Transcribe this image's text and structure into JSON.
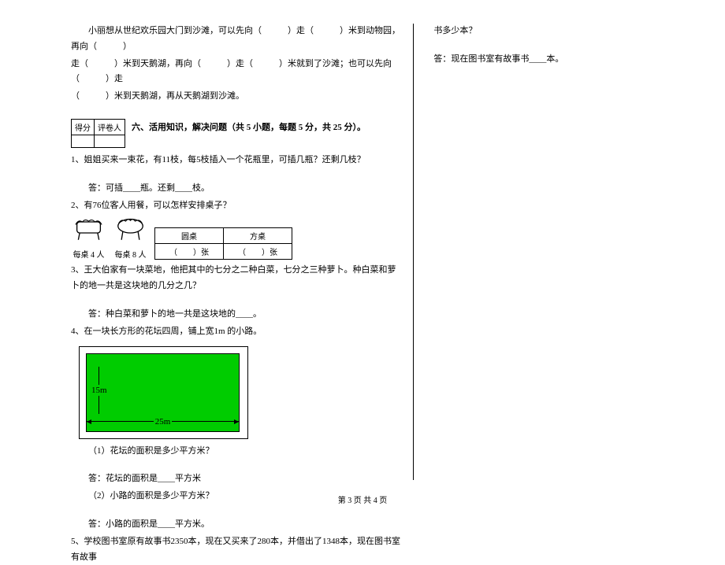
{
  "top": {
    "line1": "小丽想从世纪欢乐园大门到沙滩，可以先向（　　　）走（　　　）米到动物园，再向（　　　）",
    "line2": "走（　　　）米到天鹅湖，再向（　　　）走（　　　）米就到了沙滩；也可以先向（　　　）走",
    "line3": "（　　　）米到天鹅湖，再从天鹅湖到沙滩。"
  },
  "score": {
    "c1": "得分",
    "c2": "评卷人"
  },
  "section6": "六、活用知识，解决问题（共 5 小题，每题 5 分，共 25 分）。",
  "q1": {
    "text": "1、姐姐买来一束花，有11枝，每5枝插入一个花瓶里，可插几瓶？还剩几枝？",
    "ans": "答：可插____瓶。还剩____枝。"
  },
  "q2": {
    "text": "2、有76位客人用餐，可以怎样安排桌子？",
    "label1": "每桌 4 人",
    "label2": "每桌 8 人",
    "th1": "圆桌",
    "th2": "方桌",
    "td1": "（　　）张",
    "td2": "（　　）张"
  },
  "q3": {
    "text": "3、王大伯家有一块菜地，他把其中的七分之二种白菜，七分之三种萝卜。种白菜和萝卜的地一共是这块地的几分之几？",
    "ans": "答：种白菜和萝卜的地一共是这块地的____。"
  },
  "q4": {
    "text": "4、在一块长方形的花坛四周，铺上宽1m 的小路。",
    "dim_w": "25m",
    "dim_h": "15m",
    "sub1": "（1）花坛的面积是多少平方米？",
    "ans1": "答：花坛的面积是____平方米",
    "sub2": "（2）小路的面积是多少平方米？",
    "ans2": "答：小路的面积是____平方米。"
  },
  "q5": {
    "text": "5、学校图书室原有故事书2350本，现在又买来了280本，并借出了1348本，现在图书室有故事"
  },
  "right": {
    "line1": "书多少本？",
    "ans": "答：现在图书室有故事书____本。"
  },
  "footer": "第 3 页  共 4 页"
}
